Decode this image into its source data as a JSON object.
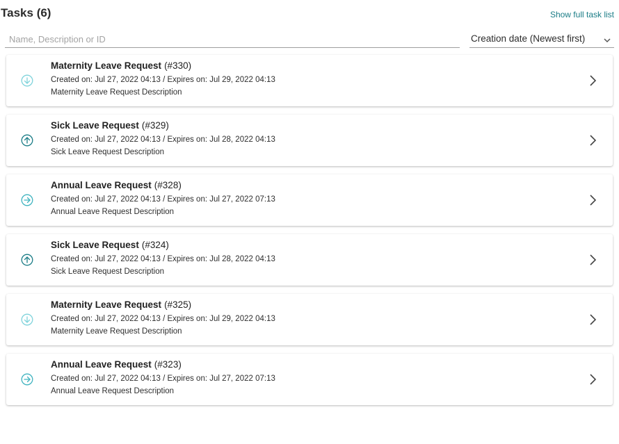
{
  "header": {
    "title": "Tasks",
    "count": "(6)",
    "show_full_label": "Show full task list"
  },
  "search": {
    "placeholder": "Name, Description or ID",
    "value": ""
  },
  "sort": {
    "selected": "Creation date (Newest first)"
  },
  "colors": {
    "accent": "#1a7c86",
    "icon_light": "#7fd3db",
    "icon_dark": "#1a7c86"
  },
  "tasks": [
    {
      "name": "Maternity Leave Request",
      "id": "(#330)",
      "dates": "Created on: Jul 27, 2022 04:13 / Expires on: Jul 29, 2022 04:13",
      "description": "Maternity Leave Request Description",
      "icon": "arrow-down-circle-icon",
      "icon_color": "light"
    },
    {
      "name": "Sick Leave Request",
      "id": "(#329)",
      "dates": "Created on: Jul 27, 2022 04:13 / Expires on: Jul 28, 2022 04:13",
      "description": "Sick Leave Request Description",
      "icon": "arrow-up-circle-icon",
      "icon_color": "dark"
    },
    {
      "name": "Annual Leave Request",
      "id": "(#328)",
      "dates": "Created on: Jul 27, 2022 04:13 / Expires on: Jul 27, 2022 07:13",
      "description": "Annual Leave Request Description",
      "icon": "arrow-right-circle-icon",
      "icon_color": "mid"
    },
    {
      "name": "Sick Leave Request",
      "id": "(#324)",
      "dates": "Created on: Jul 27, 2022 04:13 / Expires on: Jul 28, 2022 04:13",
      "description": "Sick Leave Request Description",
      "icon": "arrow-up-circle-icon",
      "icon_color": "dark"
    },
    {
      "name": "Maternity Leave Request",
      "id": "(#325)",
      "dates": "Created on: Jul 27, 2022 04:13 / Expires on: Jul 29, 2022 04:13",
      "description": "Maternity Leave Request Description",
      "icon": "arrow-down-circle-icon",
      "icon_color": "light"
    },
    {
      "name": "Annual Leave Request",
      "id": "(#323)",
      "dates": "Created on: Jul 27, 2022 04:13 / Expires on: Jul 27, 2022 07:13",
      "description": "Annual Leave Request Description",
      "icon": "arrow-right-circle-icon",
      "icon_color": "mid"
    }
  ]
}
